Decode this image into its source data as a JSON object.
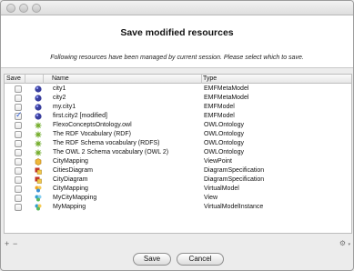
{
  "dialog": {
    "title": "Save modified resources",
    "subtitle": "Following resources have been managed by current session. Please select which to save."
  },
  "table": {
    "columns": {
      "save": "Save",
      "name": "Name",
      "type": "Type"
    },
    "rows": [
      {
        "name": "city1",
        "type": "EMFMetaModel",
        "checked": false,
        "icon": "emf-metamodel-icon"
      },
      {
        "name": "city2",
        "type": "EMFMetaModel",
        "checked": false,
        "icon": "emf-metamodel-icon"
      },
      {
        "name": "my.city1",
        "type": "EMFModel",
        "checked": false,
        "icon": "emf-model-icon"
      },
      {
        "name": "first.city2 [modified]",
        "type": "EMFModel",
        "checked": true,
        "icon": "emf-model-icon"
      },
      {
        "name": "FlexoConceptsOntology.owl",
        "type": "OWLOntology",
        "checked": false,
        "icon": "owl-ontology-icon"
      },
      {
        "name": "The RDF Vocabulary (RDF)",
        "type": "OWLOntology",
        "checked": false,
        "icon": "owl-ontology-icon"
      },
      {
        "name": "The RDF Schema vocabulary (RDFS)",
        "type": "OWLOntology",
        "checked": false,
        "icon": "owl-ontology-icon"
      },
      {
        "name": "The OWL 2 Schema vocabulary (OWL 2)",
        "type": "OWLOntology",
        "checked": false,
        "icon": "owl-ontology-icon"
      },
      {
        "name": "CityMapping",
        "type": "ViewPoint",
        "checked": false,
        "icon": "viewpoint-icon"
      },
      {
        "name": "CitiesDiagram",
        "type": "DiagramSpecification",
        "checked": false,
        "icon": "diagram-specification-icon"
      },
      {
        "name": "CityDiagram",
        "type": "DiagramSpecification",
        "checked": false,
        "icon": "diagram-specification-icon"
      },
      {
        "name": "CityMapping",
        "type": "VirtualModel",
        "checked": false,
        "icon": "virtual-model-icon"
      },
      {
        "name": "MyCityMapping",
        "type": "View",
        "checked": false,
        "icon": "view-icon"
      },
      {
        "name": "MyMapping",
        "type": "VirtualModelInstance",
        "checked": false,
        "icon": "virtual-model-instance-icon"
      }
    ]
  },
  "controls": {
    "add": "+",
    "remove": "−",
    "options": "⚙",
    "options_caret": "▾"
  },
  "buttons": {
    "save": "Save",
    "cancel": "Cancel"
  },
  "colors": {
    "emf": "#3a3f9e",
    "owl_a": "#6fae2e",
    "owl_b": "#e9a21c",
    "viewpoint": "#f0b83a",
    "diagram_red": "#c43227",
    "diagram_yellow": "#f2c84b",
    "virtual_model": "#f2a51f",
    "view": "#2f9fd3"
  }
}
